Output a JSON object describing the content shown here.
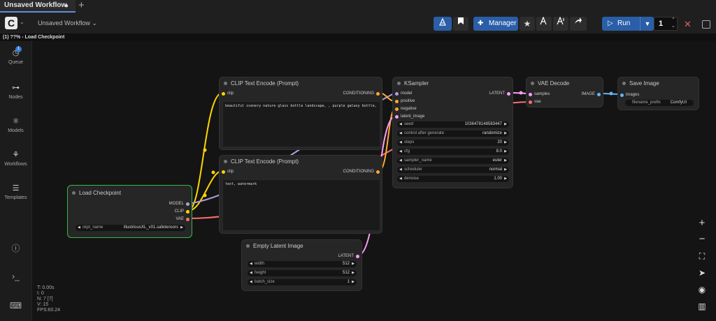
{
  "tabs": [
    {
      "label": "Unsaved Workflow",
      "modified_dot": "●"
    }
  ],
  "new_tab_icon": "+",
  "topbar": {
    "workflow_title": "Unsaved Workflow",
    "workflow_caret": "⌄",
    "logo_caret": "⌄",
    "manager_label": "Manager",
    "run_label": "Run",
    "batch_count": "1"
  },
  "breadcrumb": "(1) ??% - Load Checkpoint",
  "sidebar": {
    "queue_badge": "1",
    "items": [
      {
        "label": "Queue"
      },
      {
        "label": "Nodes"
      },
      {
        "label": "Models"
      },
      {
        "label": "Workflows"
      },
      {
        "label": "Templates"
      }
    ]
  },
  "nodes": {
    "clip1": {
      "title": "CLIP Text Encode (Prompt)",
      "in": "clip",
      "out": "CONDITIONING",
      "text": "beautiful scenery nature glass bottle landscape, , purple galaxy bottle,"
    },
    "clip2": {
      "title": "CLIP Text Encode (Prompt)",
      "in": "clip",
      "out": "CONDITIONING",
      "text": "text, watermark"
    },
    "ksampler": {
      "title": "KSampler",
      "inputs": [
        "model",
        "positive",
        "negative",
        "latent_image"
      ],
      "out": "LATENT",
      "widgets": [
        {
          "label": "seed",
          "value": "1036478148583447"
        },
        {
          "label": "control after generate",
          "value": "randomize"
        },
        {
          "label": "steps",
          "value": "20"
        },
        {
          "label": "cfg",
          "value": "8.0"
        },
        {
          "label": "sampler_name",
          "value": "euler"
        },
        {
          "label": "scheduler",
          "value": "normal"
        },
        {
          "label": "denoise",
          "value": "1.00"
        }
      ]
    },
    "vae": {
      "title": "VAE Decode",
      "inputs": [
        "samples",
        "vae"
      ],
      "out": "IMAGE"
    },
    "save": {
      "title": "Save Image",
      "in": "images",
      "widget_label": "filename_prefix",
      "widget_value": "ComfyUI"
    },
    "ckpt": {
      "title": "Load Checkpoint",
      "outs": [
        "MODEL",
        "CLIP",
        "VAE"
      ],
      "widget_label": "ckpt_name",
      "widget_value": "illustriousXL_v01.safetensors"
    },
    "latent": {
      "title": "Empty Latent Image",
      "out": "LATENT",
      "widgets": [
        {
          "label": "width",
          "value": "512"
        },
        {
          "label": "height",
          "value": "512"
        },
        {
          "label": "batch_size",
          "value": "1"
        }
      ]
    }
  },
  "stats": [
    "T: 0.00s",
    "I: 0",
    "N: 7 [7]",
    "V: 15",
    "FPS:60.24"
  ],
  "colors": {
    "clip": "#ffd500",
    "model": "#b39ddb",
    "vae": "#ff6e6e",
    "latent": "#ff9cf9",
    "cond": "#ffa931",
    "image": "#64b5f6",
    "ckpt_border": "#3bb54a"
  }
}
